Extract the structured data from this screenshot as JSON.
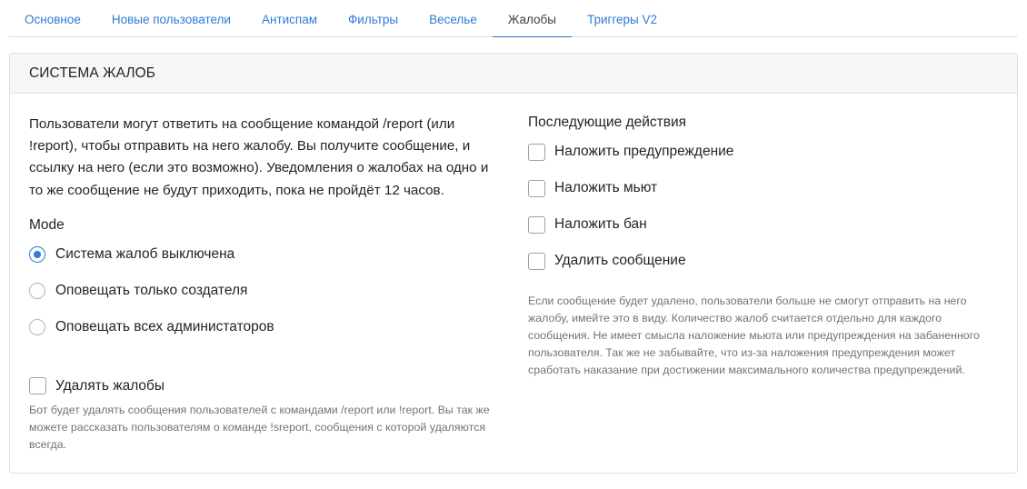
{
  "tabs": [
    {
      "label": "Основное",
      "active": false
    },
    {
      "label": "Новые пользователи",
      "active": false
    },
    {
      "label": "Антиспам",
      "active": false
    },
    {
      "label": "Фильтры",
      "active": false
    },
    {
      "label": "Веселье",
      "active": false
    },
    {
      "label": "Жалобы",
      "active": true
    },
    {
      "label": "Триггеры V2",
      "active": false
    }
  ],
  "card": {
    "title": "СИСТЕМА ЖАЛОБ",
    "description": "Пользователи могут ответить на сообщение командой /report (или !report), чтобы отправить на него жалобу. Вы получите сообщение, и ссылку на него (если это возможно). Уведомления о жалобах на одно и то же сообщение не будут приходить, пока не пройдёт 12 часов.",
    "mode": {
      "label": "Mode",
      "options": [
        {
          "label": "Система жалоб выключена",
          "checked": true
        },
        {
          "label": "Оповещать только создателя",
          "checked": false
        },
        {
          "label": "Оповещать всех администаторов",
          "checked": false
        }
      ]
    },
    "delete_reports": {
      "label": "Удалять жалобы",
      "checked": false,
      "help": "Бот будет удалять сообщения пользователей с командами /report или !report. Вы так же можете рассказать пользователям о команде !sreport, сообщения с которой удаляются всегда."
    },
    "actions": {
      "title": "Последующие действия",
      "items": [
        {
          "label": "Наложить предупреждение",
          "checked": false
        },
        {
          "label": "Наложить мьют",
          "checked": false
        },
        {
          "label": "Наложить бан",
          "checked": false
        },
        {
          "label": "Удалить сообщение",
          "checked": false
        }
      ],
      "help": "Если сообщение будет удалено, пользователи больше не смогут отправить на него жалобу, имейте это в виду. Количество жалоб считается отдельно для каждого сообщения. Не имеет смысла наложение мьюта или предупреждения на забаненного пользователя. Так же не забывайте, что из-за наложения предупреждения может сработать наказание при достижении максимального количества предупреждений."
    }
  },
  "colors": {
    "accent": "#2f7bd5",
    "header_bg": "#f6f6f6",
    "border": "#dfe1e5",
    "muted_text": "#6c757d"
  }
}
